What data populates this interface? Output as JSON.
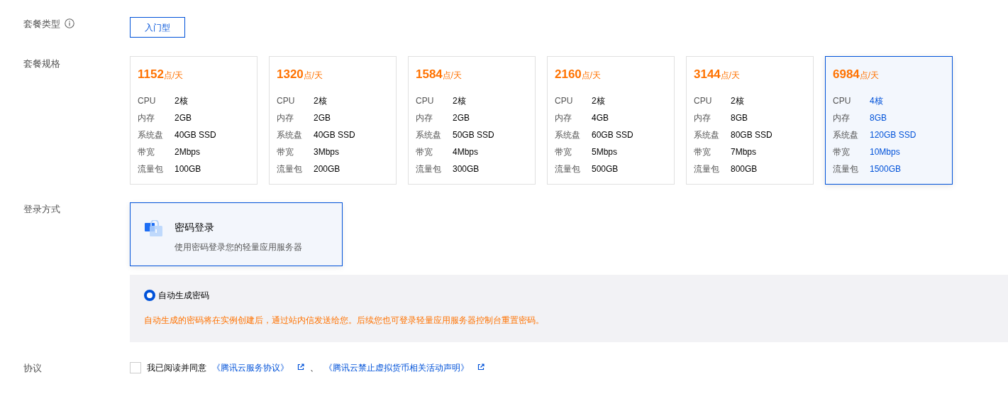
{
  "package_type": {
    "label": "套餐类型",
    "options": [
      {
        "label": "入门型",
        "selected": true
      }
    ]
  },
  "package_spec": {
    "label": "套餐规格",
    "plans": [
      {
        "price": "1152",
        "unit": "点/天",
        "selected": false,
        "specs": [
          {
            "name": "CPU",
            "value": "2核"
          },
          {
            "name": "内存",
            "value": "2GB"
          },
          {
            "name": "系统盘",
            "value": "40GB SSD"
          },
          {
            "name": "带宽",
            "value": "2Mbps"
          },
          {
            "name": "流量包",
            "value": "100GB"
          }
        ]
      },
      {
        "price": "1320",
        "unit": "点/天",
        "selected": false,
        "specs": [
          {
            "name": "CPU",
            "value": "2核"
          },
          {
            "name": "内存",
            "value": "2GB"
          },
          {
            "name": "系统盘",
            "value": "40GB SSD"
          },
          {
            "name": "带宽",
            "value": "3Mbps"
          },
          {
            "name": "流量包",
            "value": "200GB"
          }
        ]
      },
      {
        "price": "1584",
        "unit": "点/天",
        "selected": false,
        "specs": [
          {
            "name": "CPU",
            "value": "2核"
          },
          {
            "name": "内存",
            "value": "2GB"
          },
          {
            "name": "系统盘",
            "value": "50GB SSD"
          },
          {
            "name": "带宽",
            "value": "4Mbps"
          },
          {
            "name": "流量包",
            "value": "300GB"
          }
        ]
      },
      {
        "price": "2160",
        "unit": "点/天",
        "selected": false,
        "specs": [
          {
            "name": "CPU",
            "value": "2核"
          },
          {
            "name": "内存",
            "value": "4GB"
          },
          {
            "name": "系统盘",
            "value": "60GB SSD"
          },
          {
            "name": "带宽",
            "value": "5Mbps"
          },
          {
            "name": "流量包",
            "value": "500GB"
          }
        ]
      },
      {
        "price": "3144",
        "unit": "点/天",
        "selected": false,
        "specs": [
          {
            "name": "CPU",
            "value": "2核"
          },
          {
            "name": "内存",
            "value": "8GB"
          },
          {
            "name": "系统盘",
            "value": "80GB SSD"
          },
          {
            "name": "带宽",
            "value": "7Mbps"
          },
          {
            "name": "流量包",
            "value": "800GB"
          }
        ]
      },
      {
        "price": "6984",
        "unit": "点/天",
        "selected": true,
        "specs": [
          {
            "name": "CPU",
            "value": "4核"
          },
          {
            "name": "内存",
            "value": "8GB"
          },
          {
            "name": "系统盘",
            "value": "120GB SSD"
          },
          {
            "name": "带宽",
            "value": "10Mbps"
          },
          {
            "name": "流量包",
            "value": "1500GB"
          }
        ]
      }
    ]
  },
  "login": {
    "label": "登录方式",
    "methods": [
      {
        "title": "密码登录",
        "description": "使用密码登录您的轻量应用服务器",
        "selected": true
      }
    ],
    "password_options": [
      {
        "label": "自动生成密码",
        "selected": true
      }
    ],
    "hint": "自动生成的密码将在实例创建后，通过站内信发送给您。后续您也可登录轻量应用服务器控制台重置密码。"
  },
  "agreement": {
    "label": "协议",
    "checked": false,
    "text": "我已阅读并同意",
    "links": [
      "《腾讯云服务协议》",
      "《腾讯云禁止虚拟货币相关活动声明》"
    ],
    "separator": "、"
  }
}
